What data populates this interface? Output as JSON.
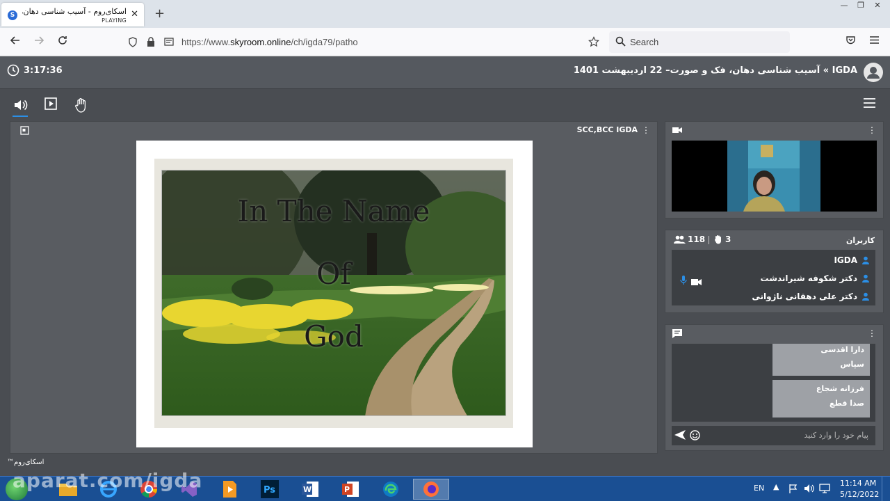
{
  "browser": {
    "tab": {
      "title": "اسکای‌روم - آسیب شناسی دهان، فـ",
      "subtitle": "PLAYING",
      "favicon": "skyroom-icon"
    },
    "url_prefix": "https://www.",
    "url_domain": "skyroom.online",
    "url_path": "/ch/igda79/patho",
    "search_placeholder": "Search"
  },
  "header": {
    "elapsed": "3:17:36",
    "room_title": "IGDA » آسیب شناسی دهان، فک و صورت– 22 اردیبهشت 1401"
  },
  "stage": {
    "presenter_label": "SCC,BCC IGDA",
    "slide_lines": [
      "In The Name",
      "Of",
      "God"
    ]
  },
  "users": {
    "title": "کاربران",
    "count": "118",
    "hands": "3",
    "list": [
      {
        "name": "IGDA"
      },
      {
        "name": "دکتر شکوفه شیراندشت"
      },
      {
        "name": "دکتر علی دهقانی ناژوانی"
      }
    ]
  },
  "chat": {
    "messages": [
      {
        "author": "دارا اقدسی",
        "text": "سپاس"
      },
      {
        "author": "فرزانه شجاع",
        "text": "صدا قطع"
      }
    ],
    "input_placeholder": "پیام خود را وارد کنید"
  },
  "footer": {
    "brand": "اسکای‌روم™"
  },
  "taskbar": {
    "lang": "EN",
    "time": "11:14 AM",
    "date": "5/12/2022",
    "watermark": "aparat.com/igda"
  },
  "colors": {
    "accent": "#2b8fe6",
    "panel": "#595c61",
    "taskbar": "#1a4f93"
  }
}
